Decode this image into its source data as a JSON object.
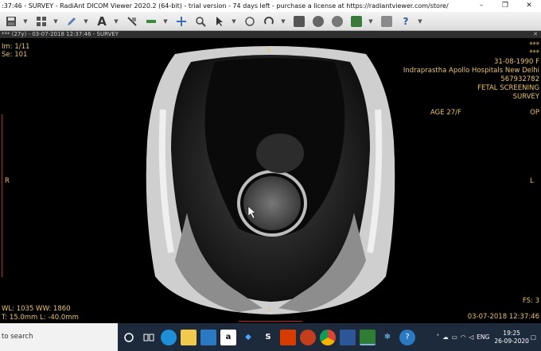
{
  "window": {
    "title": ":37:46 - SURVEY - RadiAnt DICOM Viewer 2020.2 (64-bit) - trial version - 74 days left - purchase a license at https://radiantviewer.com/store/",
    "minimize": "–",
    "maximize": "❐",
    "close": "✕"
  },
  "toolbar": {
    "icons": [
      "save-icon",
      "layout-grid-icon",
      "pencil-icon",
      "text-annotation-icon",
      "draw-tools-icon",
      "crosshair-icon",
      "magnifier-icon",
      "cursor-icon",
      "pan-icon",
      "rotate-icon",
      "reset-icon",
      "mpr-icon",
      "3d-icon",
      "export-icon",
      "settings-icon",
      "help-icon"
    ]
  },
  "series_bar": {
    "label": "*** (27y) - 03-07-2018 12:37:46 - SURVEY",
    "close": "✕"
  },
  "overlay": {
    "image_num": "Im: 1/11",
    "series_num": "Se: 101",
    "top_marker": "S",
    "bottom_marker": "I",
    "left_marker": "R",
    "right_marker": "L",
    "patient_name1": "***",
    "patient_name2": "***",
    "dob": "31-08-1990 F",
    "institution": "Indraprastha Apollo Hospitals New Delhi",
    "patient_id": "567932782",
    "study_desc": "FETAL SCREENING",
    "series_desc": "SURVEY",
    "age": "AGE 27/F",
    "op": "OP",
    "window_level": "WL: 1035 WW: 1860",
    "thickness": "T: 15.0mm L: -40.0mm",
    "fs": "FS: 3",
    "study_datetime": "03-07-2018 12:37:46"
  },
  "colors": {
    "overlay_text": "#e8c36a",
    "ruler": "#c0262a",
    "taskbar": "#1d2a3c"
  },
  "taskbar": {
    "search_placeholder": "to search",
    "apps": [
      "cortana-icon",
      "task-view-icon",
      "edge-icon",
      "explorer-icon",
      "mail-icon",
      "amazon-icon",
      "dropbox-icon",
      "app-s-icon",
      "office-icon",
      "powerpoint-icon",
      "chrome-icon",
      "word-icon",
      "radiant-icon",
      "snowflake-icon",
      "help-icon"
    ],
    "tray_lang": "ENG",
    "time": "19:25",
    "date": "26-09-2020"
  }
}
